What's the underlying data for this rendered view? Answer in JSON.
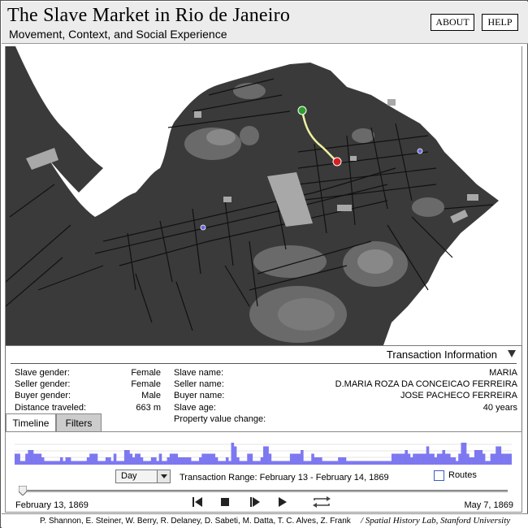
{
  "header": {
    "title": "The Slave Market in Rio de Janeiro",
    "subtitle": "Movement, Context, and Social Experience",
    "about_label": "ABOUT",
    "help_label": "HELP"
  },
  "colors": {
    "land": "#3a3a3a",
    "water": "#ffffff",
    "route": "#f0f0a0",
    "origin_marker": "#2e9e2e",
    "destination_marker": "#d42020",
    "other_marker": "#6a66e0",
    "histogram_bar": "#7d78f0"
  },
  "info": {
    "title": "Transaction Information",
    "slave_gender_label": "Slave gender:",
    "slave_gender": "Female",
    "seller_gender_label": "Seller gender:",
    "seller_gender": "Female",
    "buyer_gender_label": "Buyer gender:",
    "buyer_gender": "Male",
    "distance_label": "Distance traveled:",
    "distance": "663 m",
    "slave_name_label": "Slave name:",
    "slave_name": "MARIA",
    "seller_name_label": "Seller name:",
    "seller_name": "D.MARIA ROZA DA CONCEICAO FERREIRA",
    "buyer_name_label": "Buyer name:",
    "buyer_name": "JOSE PACHECO FERREIRA",
    "slave_age_label": "Slave age:",
    "slave_age": "40 years",
    "property_label": "Property value change:",
    "property_value": ""
  },
  "tabs": {
    "timeline": "Timeline",
    "filters": "Filters"
  },
  "timeline": {
    "granularity": "Day",
    "range_text": "Transaction Range:  February 13 - February 14, 1869",
    "routes_label": "Routes",
    "routes_checked": false,
    "start_date": "February 13, 1869",
    "end_date": "May 7, 1869",
    "slider_position": 0,
    "histogram": [
      3,
      3,
      1,
      1,
      3,
      4,
      4,
      3,
      3,
      3,
      2,
      1,
      1,
      1,
      1,
      1,
      1,
      2,
      1,
      2,
      2,
      1,
      1,
      1,
      1,
      1,
      1,
      2,
      3,
      3,
      3,
      1,
      1,
      1,
      2,
      2,
      1,
      3,
      1,
      1,
      1,
      4,
      4,
      3,
      2,
      3,
      3,
      2,
      1,
      1,
      1,
      2,
      2,
      1,
      3,
      1,
      1,
      2,
      3,
      3,
      3,
      2,
      2,
      2,
      2,
      2,
      1,
      1,
      1,
      2,
      3,
      3,
      3,
      3,
      3,
      2,
      1,
      1,
      1,
      2,
      1,
      6,
      5,
      2,
      1,
      1,
      1,
      3,
      3,
      1,
      1,
      1,
      2,
      5,
      5,
      3,
      1,
      1,
      1,
      1,
      1,
      1,
      1,
      3,
      3,
      3,
      3,
      4,
      1,
      1,
      1,
      3,
      2,
      2,
      2,
      1,
      1,
      1,
      1,
      1,
      1,
      2,
      2,
      2,
      1,
      1,
      1,
      1,
      1,
      1,
      1,
      1,
      1,
      1,
      1,
      1,
      1,
      1,
      1,
      1,
      1,
      3,
      3,
      3,
      3,
      3,
      4,
      3,
      2,
      3,
      3,
      3,
      3,
      3,
      5,
      3,
      3,
      2,
      3,
      3,
      4,
      3,
      3,
      2,
      2,
      1,
      3,
      6,
      6,
      3,
      2,
      2,
      4,
      4,
      4,
      3,
      1,
      1,
      3,
      3,
      5,
      5,
      3,
      3,
      3,
      3
    ]
  },
  "footer": {
    "credits": "P. Shannon, E. Steiner, W. Berry, R. Delaney, D. Sabeti, M. Datta, T. C. Alves, Z. Frank",
    "lab": "/ Spatial History Lab, Stanford University"
  }
}
